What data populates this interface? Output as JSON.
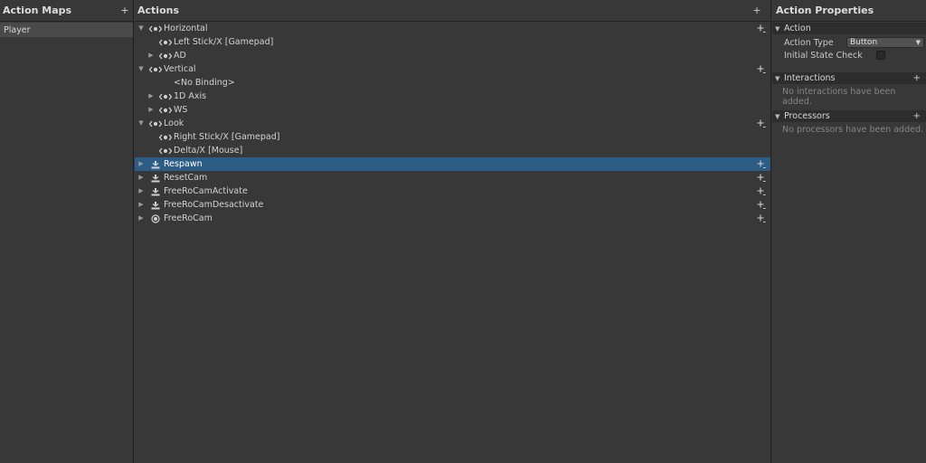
{
  "maps_pane": {
    "title": "Action Maps",
    "add": "+",
    "items": [
      {
        "label": "Player"
      }
    ]
  },
  "actions_pane": {
    "title": "Actions",
    "add": "+",
    "rows": [
      {
        "label": "Horizontal",
        "kind": "action",
        "arrow": "▼",
        "icon": "composite-icon",
        "depth": 0,
        "add": true,
        "selected": false
      },
      {
        "label": "Left Stick/X [Gamepad]",
        "kind": "binding",
        "arrow": "",
        "icon": "composite-icon",
        "depth": 1,
        "add": false,
        "selected": false
      },
      {
        "label": "AD",
        "kind": "composite",
        "arrow": "▶",
        "icon": "composite-icon",
        "depth": 1,
        "add": false,
        "selected": false
      },
      {
        "label": "Vertical",
        "kind": "action",
        "arrow": "▼",
        "icon": "composite-icon",
        "depth": 0,
        "add": true,
        "selected": false
      },
      {
        "label": "<No Binding>",
        "kind": "binding",
        "arrow": "",
        "icon": "",
        "depth": 1,
        "add": false,
        "selected": false
      },
      {
        "label": "1D Axis",
        "kind": "composite",
        "arrow": "▶",
        "icon": "composite-icon",
        "depth": 1,
        "add": false,
        "selected": false
      },
      {
        "label": "WS",
        "kind": "composite",
        "arrow": "▶",
        "icon": "composite-icon",
        "depth": 1,
        "add": false,
        "selected": false
      },
      {
        "label": "Look",
        "kind": "action",
        "arrow": "▼",
        "icon": "composite-icon",
        "depth": 0,
        "add": true,
        "selected": false
      },
      {
        "label": "Right Stick/X [Gamepad]",
        "kind": "binding",
        "arrow": "",
        "icon": "composite-icon",
        "depth": 1,
        "add": false,
        "selected": false
      },
      {
        "label": "Delta/X [Mouse]",
        "kind": "binding",
        "arrow": "",
        "icon": "composite-icon",
        "depth": 1,
        "add": false,
        "selected": false
      },
      {
        "label": "Respawn",
        "kind": "action",
        "arrow": "▶",
        "icon": "button-icon",
        "depth": 0,
        "add": true,
        "selected": true
      },
      {
        "label": "ResetCam",
        "kind": "action",
        "arrow": "▶",
        "icon": "button-icon",
        "depth": 0,
        "add": true,
        "selected": false
      },
      {
        "label": "FreeRoCamActivate",
        "kind": "action",
        "arrow": "▶",
        "icon": "button-icon",
        "depth": 0,
        "add": true,
        "selected": false
      },
      {
        "label": "FreeRoCamDesactivate",
        "kind": "action",
        "arrow": "▶",
        "icon": "button-icon",
        "depth": 0,
        "add": true,
        "selected": false
      },
      {
        "label": "FreeRoCam",
        "kind": "action",
        "arrow": "▶",
        "icon": "value-icon",
        "depth": 0,
        "add": true,
        "selected": false
      }
    ]
  },
  "props_pane": {
    "title": "Action Properties",
    "action_section": {
      "title": "Action",
      "action_type_label": "Action Type",
      "action_type_value": "Button",
      "initial_state_label": "Initial State Check",
      "initial_state_checked": false
    },
    "interactions": {
      "title": "Interactions",
      "add": "+",
      "empty": "No interactions have been added."
    },
    "processors": {
      "title": "Processors",
      "add": "+",
      "empty": "No processors have been added."
    }
  },
  "colors": {
    "background": "#383838",
    "selection": "#2c5d87",
    "section_header": "#2d2d2d"
  }
}
